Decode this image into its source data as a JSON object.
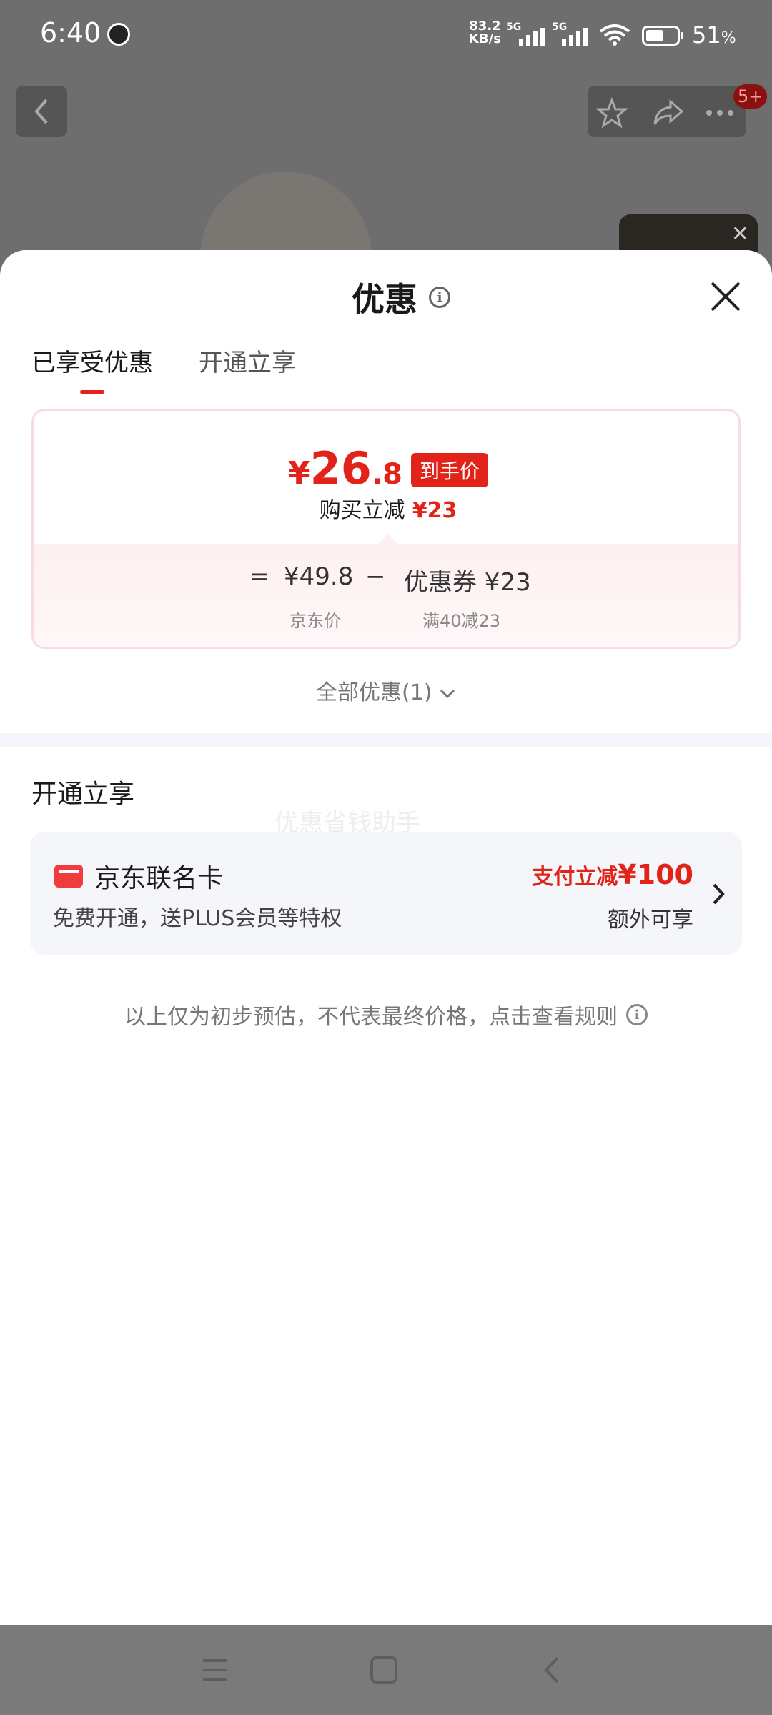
{
  "status": {
    "time": "6:40",
    "net_speed_value": "83.2",
    "net_speed_unit": "KB/s",
    "sim1": "5G",
    "sim2": "5G",
    "battery": "51",
    "battery_unit": "%"
  },
  "page": {
    "badge": "5+"
  },
  "sheet": {
    "title": "优惠",
    "tabs": [
      "已享受优惠",
      "开通立享"
    ],
    "active_tab": "已享受优惠",
    "final_price": {
      "currency": "¥",
      "integer": "26",
      "decimal": ".8",
      "tag": "到手价"
    },
    "instant_cut": {
      "label": "购买立减",
      "amount": "¥23"
    },
    "formula": {
      "eq": "=",
      "base_price": "¥49.8",
      "minus": "−",
      "coupon": "优惠券 ¥23",
      "base_label": "京东价",
      "coupon_label": "满40减23"
    },
    "all_offers": "全部优惠(1)",
    "section_title": "开通立享",
    "watermark": "优惠省钱助手",
    "card": {
      "name": "京东联名卡",
      "desc": "免费开通，送PLUS会员等特权",
      "promo_label": "支付立减",
      "promo_amount": "¥100",
      "extra": "额外可享"
    },
    "disclaimer": "以上仅为初步预估，不代表最终价格，点击查看规则"
  },
  "colors": {
    "accent": "#e2231a",
    "sheet_bg": "#ffffff",
    "card_bg": "#f5f6fa",
    "overlay": "#6e6e6e"
  }
}
